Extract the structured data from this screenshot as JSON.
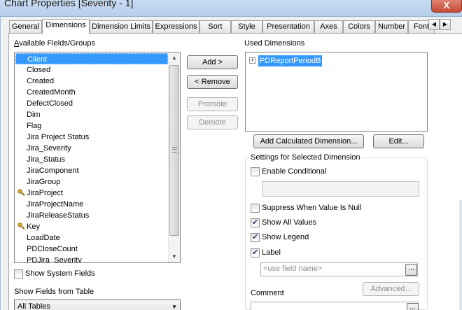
{
  "window": {
    "title": "Chart Properties [Severity - 1]",
    "close_label": "X"
  },
  "tabs": [
    {
      "label": "General"
    },
    {
      "label": "Dimensions",
      "active": true
    },
    {
      "label": "Dimension Limits"
    },
    {
      "label": "Expressions"
    },
    {
      "label": "Sort"
    },
    {
      "label": "Style"
    },
    {
      "label": "Presentation"
    },
    {
      "label": "Axes"
    },
    {
      "label": "Colors"
    },
    {
      "label": "Number"
    },
    {
      "label": "Font"
    }
  ],
  "available": {
    "label": "Available Fields/Groups",
    "items": [
      {
        "label": "Client",
        "selected": true,
        "key": false
      },
      {
        "label": "Closed",
        "key": false
      },
      {
        "label": "Created",
        "key": false
      },
      {
        "label": "CreatedMonth",
        "key": false
      },
      {
        "label": "DefectClosed",
        "key": false
      },
      {
        "label": "Dim",
        "key": false
      },
      {
        "label": "Flag",
        "key": false
      },
      {
        "label": "Jira Project Status",
        "key": false
      },
      {
        "label": "Jira_Severity",
        "key": false
      },
      {
        "label": "Jira_Status",
        "key": false
      },
      {
        "label": "JiraComponent",
        "key": false
      },
      {
        "label": "JiraGroup",
        "key": false
      },
      {
        "label": "JiraProject",
        "key": true
      },
      {
        "label": "JiraProjectName",
        "key": false
      },
      {
        "label": "JiraReleaseStatus",
        "key": false
      },
      {
        "label": "Key",
        "key": true
      },
      {
        "label": "LoadDate",
        "key": false
      },
      {
        "label": "PDCloseCount",
        "key": false
      },
      {
        "label": "PDJira_Severity",
        "key": false
      }
    ]
  },
  "buttons": {
    "add": "Add >",
    "remove": "< Remove",
    "promote": "Promote",
    "demote": "Demote",
    "add_calculated": "Add Calculated Dimension...",
    "edit": "Edit...",
    "advanced": "Advanced..."
  },
  "used": {
    "label": "Used Dimensions",
    "items": [
      {
        "label": "PDReportPeriodB"
      }
    ]
  },
  "show_system_fields": {
    "label": "Show System Fields",
    "checked": false
  },
  "show_fields_from_table": {
    "label": "Show Fields from Table",
    "value": "All Tables"
  },
  "settings": {
    "title": "Settings for Selected Dimension",
    "enable_conditional": {
      "label": "Enable Conditional",
      "checked": false
    },
    "suppress_null": {
      "label": "Suppress When Value Is Null",
      "checked": false
    },
    "show_all_values": {
      "label": "Show All Values",
      "checked": true
    },
    "show_legend": {
      "label": "Show Legend",
      "checked": true
    },
    "label": {
      "label": "Label",
      "checked": true,
      "placeholder": "<use field name>"
    },
    "comment": {
      "label": "Comment"
    }
  },
  "colors": {
    "selection": "#3399ff"
  }
}
